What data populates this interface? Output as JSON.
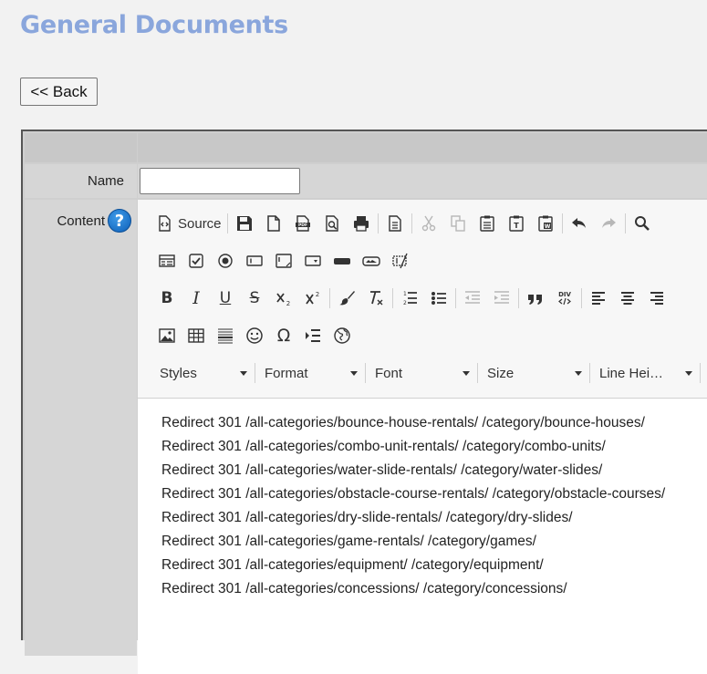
{
  "page": {
    "title": "General Documents"
  },
  "back_button": {
    "label": "<< Back"
  },
  "form": {
    "name_label": "Name",
    "name_value": "",
    "content_label": "Content",
    "help_glyph": "?"
  },
  "toolbar": {
    "source_label": "Source",
    "dropdowns": {
      "styles": "Styles",
      "format": "Format",
      "font": "Font",
      "size": "Size",
      "line_height": "Line Hei…"
    }
  },
  "editor_content": {
    "lines": [
      "Redirect 301 /all-categories/bounce-house-rentals/ /category/bounce-houses/",
      "Redirect 301 /all-categories/combo-unit-rentals/ /category/combo-units/",
      "Redirect 301 /all-categories/water-slide-rentals/ /category/water-slides/",
      "Redirect 301 /all-categories/obstacle-course-rentals/ /category/obstacle-courses/",
      "Redirect 301 /all-categories/dry-slide-rentals/ /category/dry-slides/",
      "Redirect 301 /all-categories/game-rentals/ /category/games/",
      "Redirect 301 /all-categories/equipment/ /category/equipment/",
      "Redirect 301 /all-categories/concessions/ /category/concessions/"
    ]
  }
}
